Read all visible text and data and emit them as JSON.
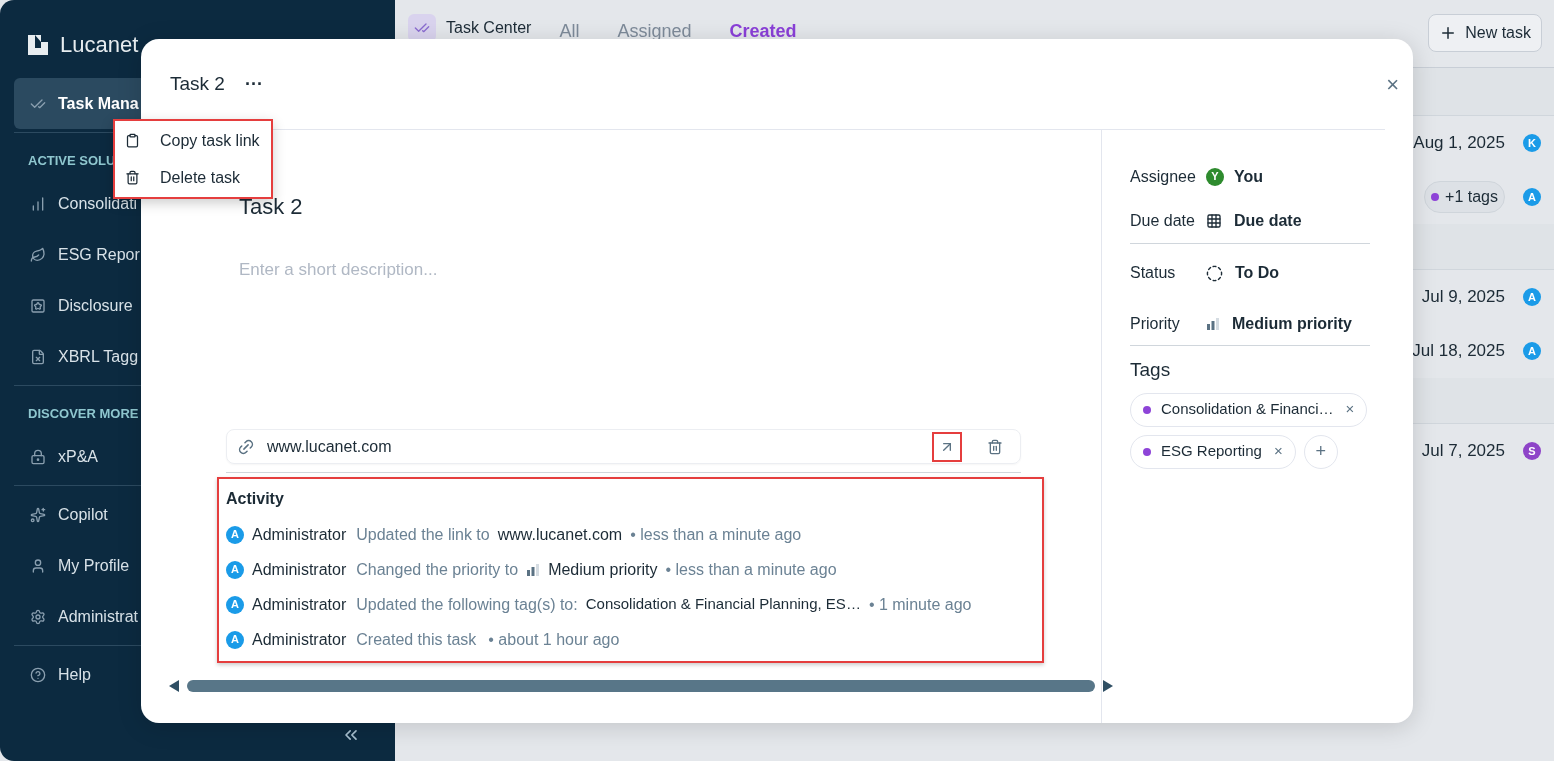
{
  "sidebar": {
    "logo": "Lucanet",
    "sections": [
      {
        "items": [
          {
            "label": "Task Mana",
            "selected": true
          }
        ]
      },
      {
        "header": "ACTIVE SOLU",
        "items": [
          {
            "label": "Consolidati",
            "selected": false
          },
          {
            "label": "ESG Repor",
            "selected": false
          },
          {
            "label": "Disclosure",
            "selected": false
          },
          {
            "label": "XBRL Tagg",
            "selected": false
          }
        ]
      },
      {
        "header": "DISCOVER MORE",
        "items": [
          {
            "label": "xP&A",
            "selected": false
          }
        ]
      },
      {
        "items": [
          {
            "label": "Copilot",
            "selected": false
          },
          {
            "label": "My Profile",
            "selected": false
          },
          {
            "label": "Administrat",
            "selected": false
          }
        ]
      },
      {
        "items": [
          {
            "label": "Help",
            "selected": false
          }
        ]
      }
    ]
  },
  "header": {
    "title": "Task Center",
    "tabs": [
      {
        "label": "All",
        "selected": false
      },
      {
        "label": "Assigned",
        "selected": false
      },
      {
        "label": "Created",
        "selected": true
      }
    ],
    "new_button": "New task"
  },
  "rows": [
    {
      "kind": "group"
    },
    {
      "kind": "task",
      "date": "Aug 1, 2025",
      "avatar": "K",
      "color": "#1a9be8"
    },
    {
      "kind": "task",
      "tags": "+1 tags",
      "avatar": "A",
      "color": "#1a9be8"
    },
    {
      "kind": "group"
    },
    {
      "kind": "task",
      "date": "Jul 9, 2025",
      "avatar": "A",
      "color": "#1a9be8"
    },
    {
      "kind": "task",
      "date": "Jul 18, 2025",
      "avatar": "A",
      "color": "#1a9be8"
    },
    {
      "kind": "group"
    },
    {
      "kind": "task",
      "date": "Jul 7, 2025",
      "avatar": "S",
      "color": "#8e44c8"
    }
  ],
  "modal": {
    "title": "Task 2",
    "more": "···",
    "close": "×",
    "menu": [
      "Copy task link",
      "Delete task"
    ],
    "task_title": "Task 2",
    "description_placeholder": "Enter a short description...",
    "link": "www.lucanet.com",
    "activity": {
      "title": "Activity",
      "entries": [
        {
          "kind": "link",
          "avatar": "A",
          "actor": "Administrator",
          "action": "Updated the link to",
          "value": "www.lucanet.com",
          "time": "• less than a minute ago"
        },
        {
          "kind": "priority",
          "avatar": "A",
          "actor": "Administrator",
          "action": "Changed the priority to",
          "value": "Medium priority",
          "time": "• less than a minute ago"
        },
        {
          "kind": "tags",
          "avatar": "A",
          "actor": "Administrator",
          "action": "Updated the following tag(s) to:",
          "value": "Consolidation & Financial Planning, ES…",
          "time": "• 1 minute ago"
        },
        {
          "kind": "created",
          "avatar": "A",
          "actor": "Administrator",
          "action": "Created this task",
          "time": "• about 1 hour ago"
        }
      ]
    },
    "details": {
      "assignee_label": "Assignee",
      "assignee_avatar": "Y",
      "assignee": "You",
      "due_label": "Due date",
      "due": "Due date",
      "status_label": "Status",
      "status": "To Do",
      "priority_label": "Priority",
      "priority": "Medium priority",
      "tags_title": "Tags",
      "tags": [
        {
          "label": "Consolidation & Financi…",
          "color": "#8e44d8"
        },
        {
          "label": "ESG Reporting",
          "color": "#8e44d8"
        }
      ],
      "tag_remove": "×",
      "add_tag": "+"
    }
  }
}
